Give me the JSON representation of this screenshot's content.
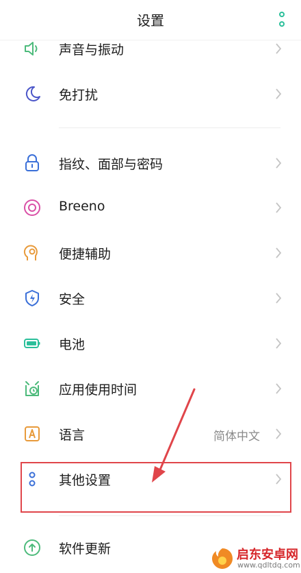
{
  "header": {
    "title": "设置",
    "more_icon": "vertical-dots-icon"
  },
  "items": [
    {
      "id": "sound",
      "label": "声音与振动",
      "icon": "speaker-icon"
    },
    {
      "id": "dnd",
      "label": "免打扰",
      "icon": "moon-icon"
    },
    {
      "id": "security-pass",
      "label": "指纹、面部与密码",
      "icon": "lock-icon"
    },
    {
      "id": "breeno",
      "label": "Breeno",
      "icon": "breeno-icon"
    },
    {
      "id": "accessibility",
      "label": "便捷辅助",
      "icon": "head-gear-icon"
    },
    {
      "id": "safety",
      "label": "安全",
      "icon": "shield-icon"
    },
    {
      "id": "battery",
      "label": "电池",
      "icon": "battery-icon"
    },
    {
      "id": "app-usage",
      "label": "应用使用时间",
      "icon": "clock-icon"
    },
    {
      "id": "language",
      "label": "语言",
      "value": "简体中文",
      "icon": "letter-a-icon"
    },
    {
      "id": "other",
      "label": "其他设置",
      "icon": "two-circles-icon"
    },
    {
      "id": "update",
      "label": "软件更新",
      "icon": "arrow-up-circle-icon"
    }
  ],
  "watermark": {
    "name": "启东安卓网",
    "url": "www.qdltdq.com"
  },
  "colors": {
    "accent": "#2bbf9a",
    "highlight": "#e0454a",
    "chevron": "#c4c4c4"
  }
}
